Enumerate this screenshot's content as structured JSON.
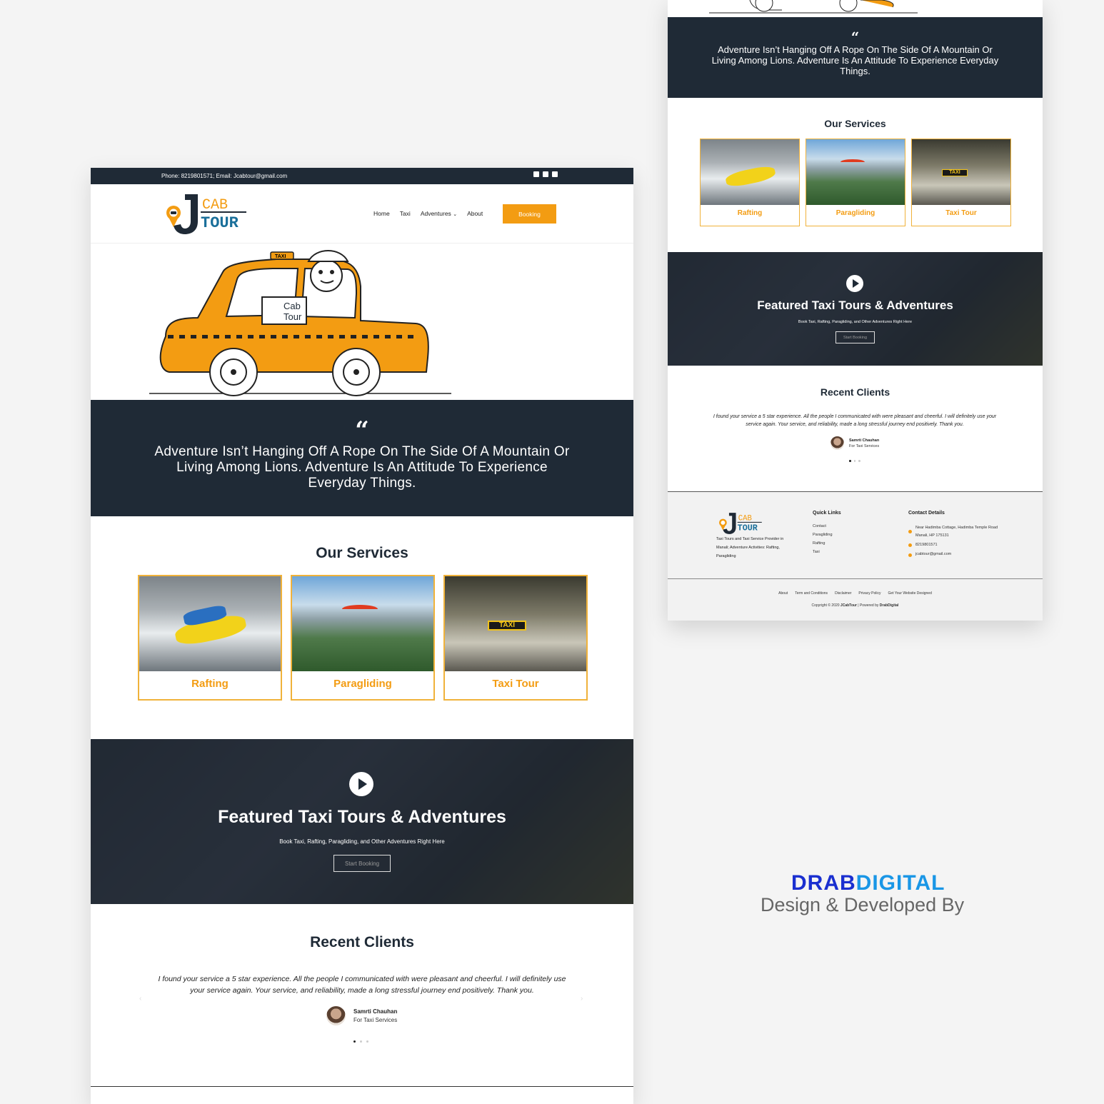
{
  "main": {
    "topbar": {
      "contact": "Phone: 8219801571; Email: Jcabtour@gmail.com",
      "social_icons": [
        "facebook-icon",
        "instagram-icon",
        "twitter-icon"
      ]
    },
    "logo": {
      "letter": "J",
      "line1": "CAB",
      "line2": "TOUR"
    },
    "nav": {
      "home": "Home",
      "taxi": "Taxi",
      "adventures": "Adventures",
      "about": "About",
      "booking": "Booking"
    },
    "hero": {
      "sign_line1": "Cab",
      "sign_line2": "Tour",
      "roof_sign": "TAXI"
    },
    "quote": "Adventure Isn’t Hanging Off A Rope On The Side Of A Mountain Or Living Among Lions. Adventure Is An Attitude To Experience Everyday Things.",
    "services": {
      "title": "Our Services",
      "items": [
        {
          "label": "Rafting"
        },
        {
          "label": "Paragliding"
        },
        {
          "label": "Taxi Tour"
        }
      ],
      "taxi_sign": "TAXI"
    },
    "featured": {
      "title": "Featured Taxi Tours & Adventures",
      "subtitle": "Book Taxi, Rafting, Paragliding, and Other Adventures Right Here",
      "button": "Start Booking"
    },
    "clients": {
      "title": "Recent Clients",
      "testimonial": "I found your service a 5 star experience. All the people I communicated with were pleasant and cheerful. I will definitely use your service again. Your service, and reliability, made a long stressful journey end positively. Thank you.",
      "name": "Samrti Chauhan",
      "role": "For Taxi Services"
    }
  },
  "right": {
    "footer": {
      "desc": "Taxi Tours and Taxi Service Provider in Manali; Adventure Activities: Rafting, Paragliding",
      "quick_links_title": "Quick Links",
      "quick_links": [
        "Contact",
        "Paragliding",
        "Rafting",
        "Taxi"
      ],
      "contact_title": "Contact Details",
      "address": "Near Hadimba Cottage, Hadimba Temple Road Manali, HP 175131",
      "phone": "8219801571",
      "email": "jcabtour@gmail.com",
      "bottom_links": [
        "About",
        "Term and Conditions",
        "Disclaimer",
        "Privacy Policy",
        "Get Your Website Designed"
      ],
      "copyright_prefix": "Copyright © 2020 ",
      "copyright_brand": "JCabTour",
      "copyright_mid": " | Powered by ",
      "copyright_powered": "DrabDigital"
    }
  },
  "credit": {
    "brand_a": "DRAB",
    "brand_b": "DIGITAL",
    "tagline": "Design & Developed By"
  },
  "colors": {
    "accent": "#f39c12",
    "dark": "#1f2a36",
    "brand_blue": "#1a2fd0"
  }
}
